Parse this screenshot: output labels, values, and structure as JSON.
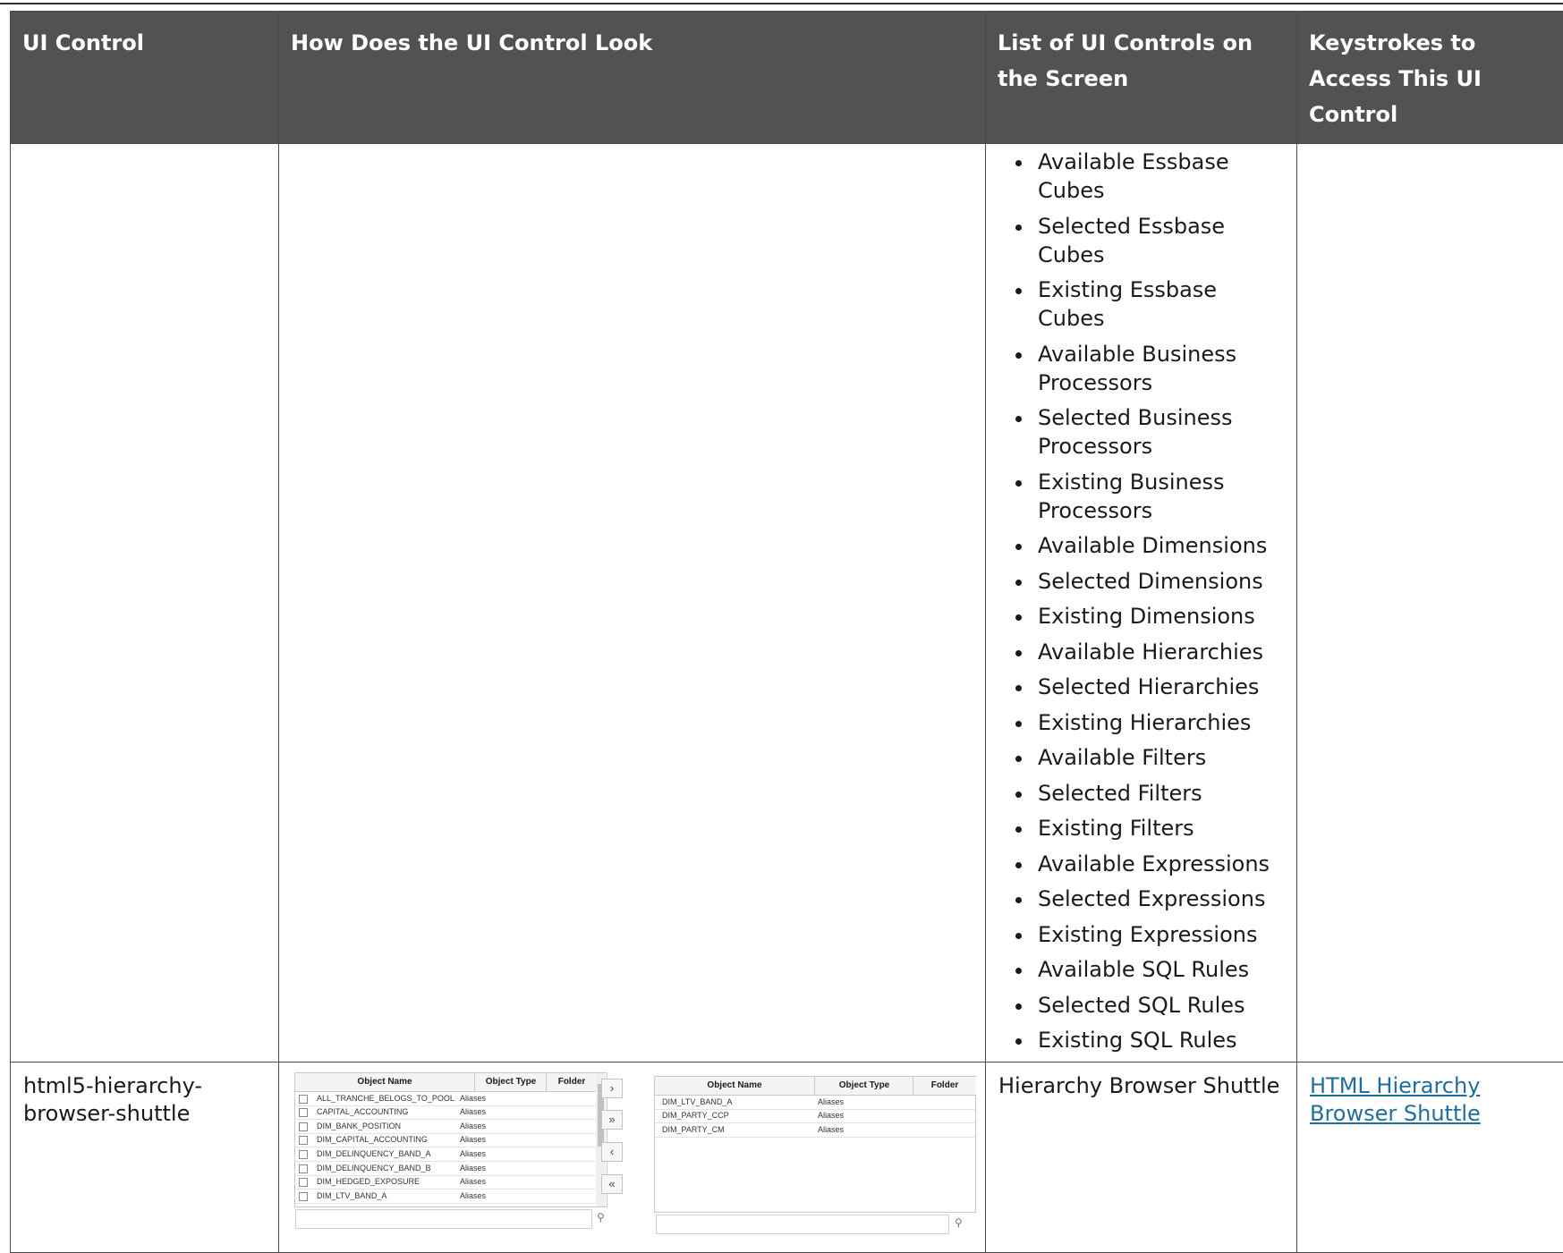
{
  "header": {
    "col1": "UI Control",
    "col2": "How Does the UI Control Look",
    "col3": "List of UI Controls on the Screen",
    "col4": "Keystrokes to Access This UI Control"
  },
  "row1": {
    "controls": [
      "Available Essbase Cubes",
      "Selected Essbase Cubes",
      "Existing Essbase Cubes",
      "Available Business Processors",
      "Selected Business Processors",
      "Existing Business Processors",
      "Available Dimensions",
      "Selected Dimensions",
      "Existing Dimensions",
      "Available Hierarchies",
      "Selected Hierarchies",
      "Existing Hierarchies",
      "Available Filters",
      "Selected Filters",
      "Existing Filters",
      "Available Expressions",
      "Selected Expressions",
      "Existing Expressions",
      "Available SQL Rules",
      "Selected SQL Rules",
      "Existing SQL Rules"
    ]
  },
  "row2": {
    "ui_control": "html5-hierarchy-browser-shuttle",
    "list_text": "Hierarchy Browser Shuttle",
    "link_text": "HTML Hierarchy Browser Shuttle",
    "shuttle": {
      "left_headers": [
        "Object Name",
        "Object Type",
        "Folder"
      ],
      "left_rows": [
        [
          "ALL_TRANCHE_BELOGS_TO_POOL",
          "Aliases"
        ],
        [
          "CAPITAL_ACCOUNTING",
          "Aliases"
        ],
        [
          "DIM_BANK_POSITION",
          "Aliases"
        ],
        [
          "DIM_CAPITAL_ACCOUNTING",
          "Aliases"
        ],
        [
          "DIM_DELINQUENCY_BAND_A",
          "Aliases"
        ],
        [
          "DIM_DELINQUENCY_BAND_B",
          "Aliases"
        ],
        [
          "DIM_HEDGED_EXPOSURE",
          "Aliases"
        ],
        [
          "DIM_LTV_BAND_A",
          "Aliases"
        ]
      ],
      "right_headers": [
        "Object Name",
        "Object Type",
        "Folder"
      ],
      "right_rows": [
        [
          "DIM_LTV_BAND_A",
          "Aliases"
        ],
        [
          "DIM_PARTY_CCP",
          "Aliases"
        ],
        [
          "DIM_PARTY_CM",
          "Aliases"
        ]
      ],
      "buttons": [
        "›",
        "»",
        "‹",
        "«"
      ],
      "icons": [
        "search-icon",
        "search-icon"
      ]
    }
  }
}
